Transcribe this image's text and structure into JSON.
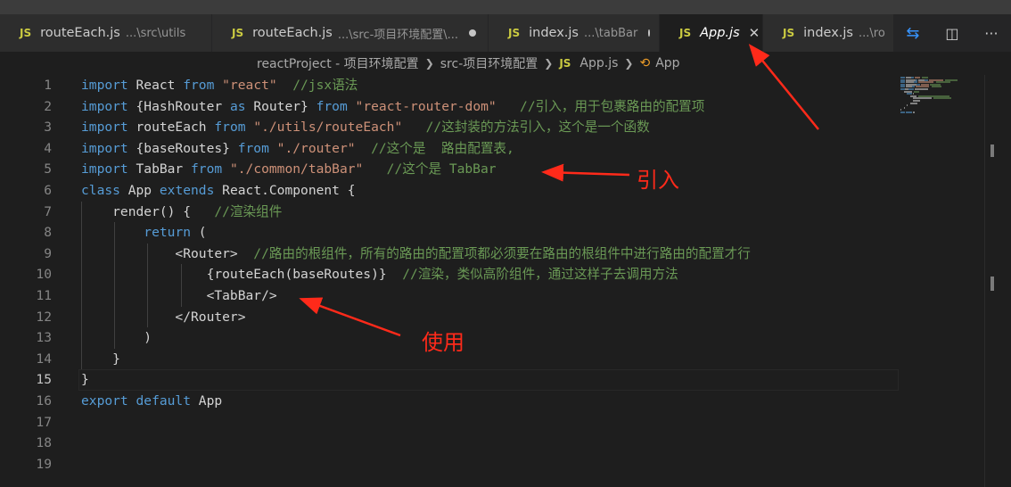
{
  "tabs": [
    {
      "name": "routeEach.js",
      "desc": "...\\src\\utils",
      "icon": "JS",
      "dirty": false,
      "active": false,
      "close": false
    },
    {
      "name": "routeEach.js",
      "desc": "...\\src-项目环境配置\\...",
      "icon": "JS",
      "dirty": true,
      "active": false,
      "close": false
    },
    {
      "name": "index.js",
      "desc": "...\\tabBar",
      "icon": "JS",
      "dirty": true,
      "active": false,
      "close": false
    },
    {
      "name": "App.js",
      "desc": "",
      "icon": "JS",
      "dirty": false,
      "active": true,
      "close": true
    },
    {
      "name": "index.js",
      "desc": "...\\ro",
      "icon": "JS",
      "dirty": false,
      "active": false,
      "close": false
    }
  ],
  "close_glyph": "✕",
  "breadcrumb": {
    "items": [
      "reactProject - 项目环境配置",
      "src-项目环境配置",
      "App.js",
      "App"
    ],
    "file_icon": "JS",
    "symbol_icon": "⟲"
  },
  "code": {
    "lines": [
      [
        [
          "kw",
          "import"
        ],
        [
          "id",
          " React "
        ],
        [
          "kw",
          "from"
        ],
        [
          "str",
          " \"react\""
        ],
        [
          "cm",
          "  //jsx语法"
        ]
      ],
      [
        [
          "kw",
          "import"
        ],
        [
          "id",
          " {HashRouter "
        ],
        [
          "kw",
          "as"
        ],
        [
          "id",
          " Router} "
        ],
        [
          "kw",
          "from"
        ],
        [
          "str",
          " \"react-router-dom\""
        ],
        [
          "cm",
          "   //引入，用于包裹路由的配置项"
        ]
      ],
      [
        [
          "kw",
          "import"
        ],
        [
          "id",
          " routeEach "
        ],
        [
          "kw",
          "from"
        ],
        [
          "str",
          " \"./utils/routeEach\""
        ],
        [
          "cm",
          "   //这封装的方法引入，这个是一个函数"
        ]
      ],
      [
        [
          "kw",
          "import"
        ],
        [
          "id",
          " {baseRoutes} "
        ],
        [
          "kw",
          "from"
        ],
        [
          "str",
          " \"./router\""
        ],
        [
          "cm",
          "  //这个是  路由配置表,"
        ]
      ],
      [
        [
          "kw",
          "import"
        ],
        [
          "id",
          " TabBar "
        ],
        [
          "kw",
          "from"
        ],
        [
          "str",
          " \"./common/tabBar\""
        ],
        [
          "cm",
          "   //这个是 TabBar"
        ]
      ],
      [
        [
          "kw",
          "class"
        ],
        [
          "id",
          " App "
        ],
        [
          "kw",
          "extends"
        ],
        [
          "id",
          " React.Component {"
        ]
      ],
      [
        [
          "id",
          "    render() {"
        ],
        [
          "cm",
          "   //渲染组件"
        ]
      ],
      [
        [
          "id",
          "        "
        ],
        [
          "kw",
          "return"
        ],
        [
          "id",
          " ("
        ]
      ],
      [
        [
          "id",
          "            <Router>"
        ],
        [
          "cm",
          "  //路由的根组件，所有的路由的配置项都必须要在路由的根组件中进行路由的配置才行"
        ]
      ],
      [
        [
          "id",
          "                {routeEach(baseRoutes)}"
        ],
        [
          "cm",
          "  //渲染，类似高阶组件，通过这样子去调用方法"
        ]
      ],
      [
        [
          "id",
          "                <TabBar/>"
        ]
      ],
      [
        [
          "id",
          "            </Router>"
        ]
      ],
      [
        [
          "id",
          "        )"
        ]
      ],
      [
        [
          "id",
          "    }"
        ]
      ],
      [
        [
          "id",
          "}"
        ]
      ],
      [
        [
          "kw",
          "export"
        ],
        [
          "kw",
          " default"
        ],
        [
          "id",
          " App"
        ]
      ],
      [],
      [],
      []
    ],
    "current_line": 15
  },
  "annotations": {
    "import_label": "引入",
    "use_label": "使用"
  },
  "actions": {
    "compare": "⇆",
    "split": "◫",
    "more": "···"
  },
  "colors": {
    "keyword": "#569cd6",
    "string": "#ce9178",
    "comment": "#6a9955",
    "identifier": "#d4d4d4",
    "annotation": "#ff2a1a",
    "js_icon": "#cbcb41"
  }
}
